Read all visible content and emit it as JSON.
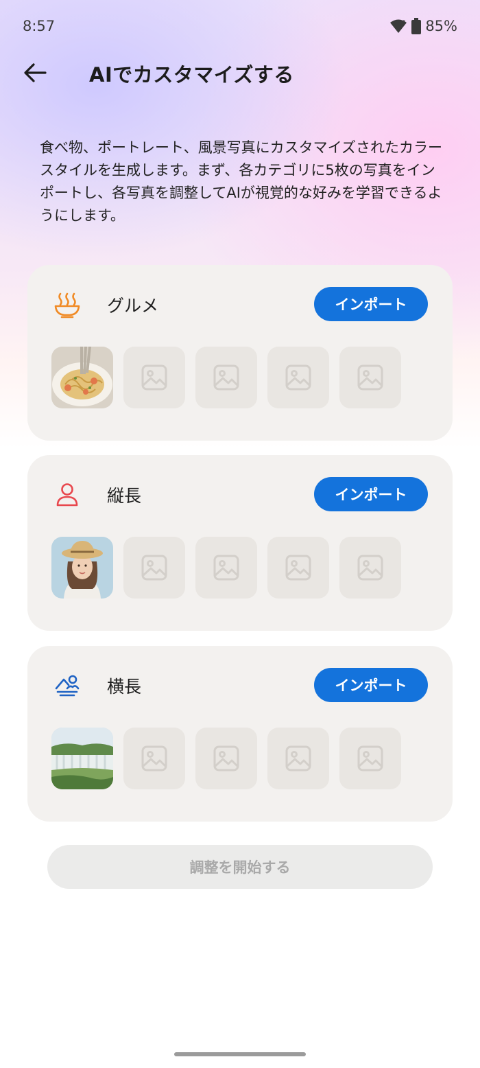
{
  "status_bar": {
    "time": "8:57",
    "battery": "85%"
  },
  "header": {
    "title": "AIでカスタマイズする"
  },
  "description": "食べ物、ポートレート、風景写真にカスタマイズされたカラースタイルを生成します。まず、各カテゴリに5枚の写真をインポートし、各写真を調整してAIが視覚的な好みを学習できるようにします。",
  "categories": [
    {
      "name": "グルメ",
      "import_label": "インポート",
      "icon": "food-bowl-icon",
      "icon_color": "#f08a24"
    },
    {
      "name": "縦長",
      "import_label": "インポート",
      "icon": "person-icon",
      "icon_color": "#e8474d"
    },
    {
      "name": "横長",
      "import_label": "インポート",
      "icon": "landscape-icon",
      "icon_color": "#1f63c4"
    }
  ],
  "start_button": {
    "label": "調整を開始する"
  },
  "colors": {
    "accent": "#1473dc",
    "card_bg": "#f3f1ef",
    "disabled_bg": "#ebebea",
    "disabled_text": "#a9a9a9"
  }
}
